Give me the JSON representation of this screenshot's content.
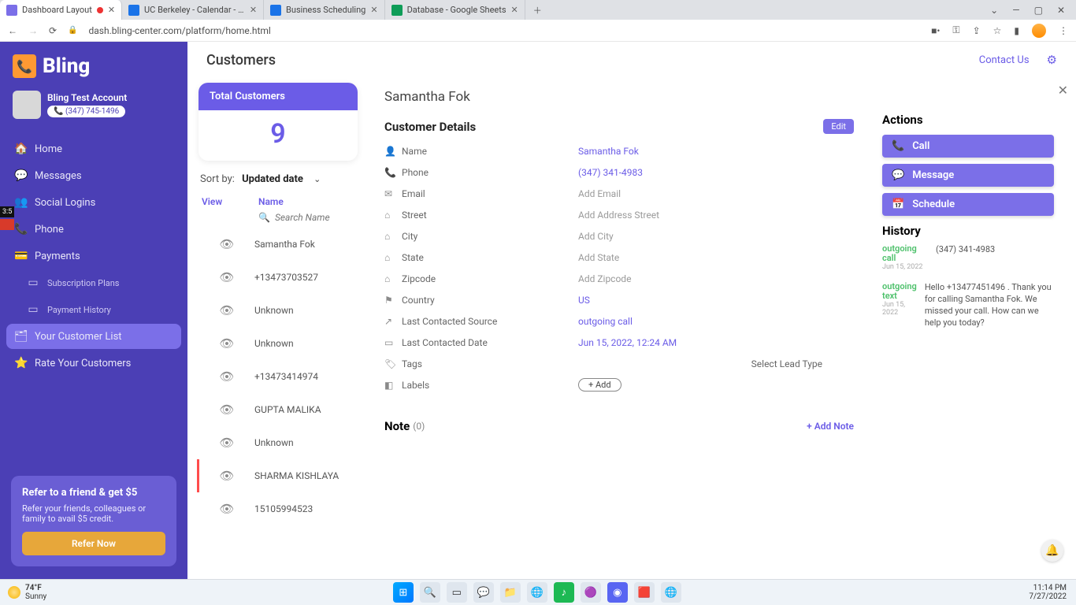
{
  "browser": {
    "tabs": [
      {
        "title": "Dashboard Layout",
        "favicon": "#7b6fe8",
        "recording": true
      },
      {
        "title": "UC Berkeley - Calendar - Week o",
        "favicon": "#1a73e8"
      },
      {
        "title": "Business Scheduling",
        "favicon": "#1a73e8"
      },
      {
        "title": "Database - Google Sheets",
        "favicon": "#0f9d58"
      }
    ],
    "url": "dash.bling-center.com/platform/home.html"
  },
  "sidebar": {
    "brand": "Bling",
    "account_name": "Bling Test Account",
    "account_phone": "(347) 745-1496",
    "items": [
      {
        "icon": "🏠",
        "label": "Home"
      },
      {
        "icon": "💬",
        "label": "Messages"
      },
      {
        "icon": "👥",
        "label": "Social Logins"
      },
      {
        "icon": "📞",
        "label": "Phone"
      },
      {
        "icon": "💳",
        "label": "Payments"
      }
    ],
    "subitems": [
      {
        "label": "Subscription Plans"
      },
      {
        "label": "Payment History"
      }
    ],
    "active": {
      "icon": "🗂",
      "label": "Your Customer List"
    },
    "rate": {
      "icon": "⭐",
      "label": "Rate Your Customers"
    },
    "refer": {
      "title": "Refer to a friend & get $5",
      "body": "Refer your friends, colleagues or family to avail $5 credit.",
      "button": "Refer Now"
    },
    "edge_badge": "3:5"
  },
  "topbar": {
    "page_title": "Customers",
    "contact": "Contact Us"
  },
  "list": {
    "total_label": "Total Customers",
    "total_value": "9",
    "sort_label": "Sort by:",
    "sort_value": "Updated date",
    "col_view": "View",
    "col_name": "Name",
    "search_placeholder": "Search Name",
    "rows": [
      {
        "name": "Samantha Fok",
        "selected": false
      },
      {
        "name": "+13473703527",
        "selected": false
      },
      {
        "name": "Unknown",
        "selected": false
      },
      {
        "name": "Unknown",
        "selected": false
      },
      {
        "name": "+13473414974",
        "selected": false
      },
      {
        "name": "GUPTA MALIKA",
        "selected": false
      },
      {
        "name": "Unknown",
        "selected": false
      },
      {
        "name": "SHARMA KISHLAYA",
        "selected": true
      },
      {
        "name": "15105994523",
        "selected": false
      }
    ]
  },
  "detail": {
    "title": "Samantha Fok",
    "section": "Customer Details",
    "edit": "Edit",
    "fields": [
      {
        "icon": "👤",
        "label": "Name",
        "value": "Samantha Fok",
        "filled": true
      },
      {
        "icon": "📞",
        "label": "Phone",
        "value": "(347) 341-4983",
        "filled": true
      },
      {
        "icon": "✉",
        "label": "Email",
        "value": "Add Email",
        "filled": false
      },
      {
        "icon": "⌂",
        "label": "Street",
        "value": "Add Address Street",
        "filled": false
      },
      {
        "icon": "⌂",
        "label": "City",
        "value": "Add City",
        "filled": false
      },
      {
        "icon": "⌂",
        "label": "State",
        "value": "Add State",
        "filled": false
      },
      {
        "icon": "⌂",
        "label": "Zipcode",
        "value": "Add Zipcode",
        "filled": false
      },
      {
        "icon": "⚑",
        "label": "Country",
        "value": "US",
        "filled": true
      },
      {
        "icon": "↗",
        "label": "Last Contacted Source",
        "value": "outgoing call",
        "filled": true
      },
      {
        "icon": "▭",
        "label": "Last Contacted Date",
        "value": "Jun 15, 2022, 12:24 AM",
        "filled": true
      }
    ],
    "tags_label": "Tags",
    "lead_type": "Select Lead Type",
    "labels_label": "Labels",
    "add_pill": "+ Add",
    "note_label": "Note",
    "note_count": "(0)",
    "add_note": "+ Add Note"
  },
  "actions": {
    "title": "Actions",
    "buttons": [
      {
        "icon": "📞",
        "label": "Call"
      },
      {
        "icon": "💬",
        "label": "Message"
      },
      {
        "icon": "📅",
        "label": "Schedule"
      }
    ],
    "history_title": "History",
    "history": [
      {
        "type": "outgoing call",
        "date": "Jun 15, 2022",
        "body": "(347) 341-4983"
      },
      {
        "type": "outgoing text",
        "date": "Jun 15, 2022",
        "body": "Hello +13477451496 . Thank you for calling Samantha Fok. We missed your call. How can we help you today?"
      }
    ]
  },
  "taskbar": {
    "temp": "74°F",
    "cond": "Sunny",
    "time": "11:14 PM",
    "date": "7/27/2022"
  }
}
